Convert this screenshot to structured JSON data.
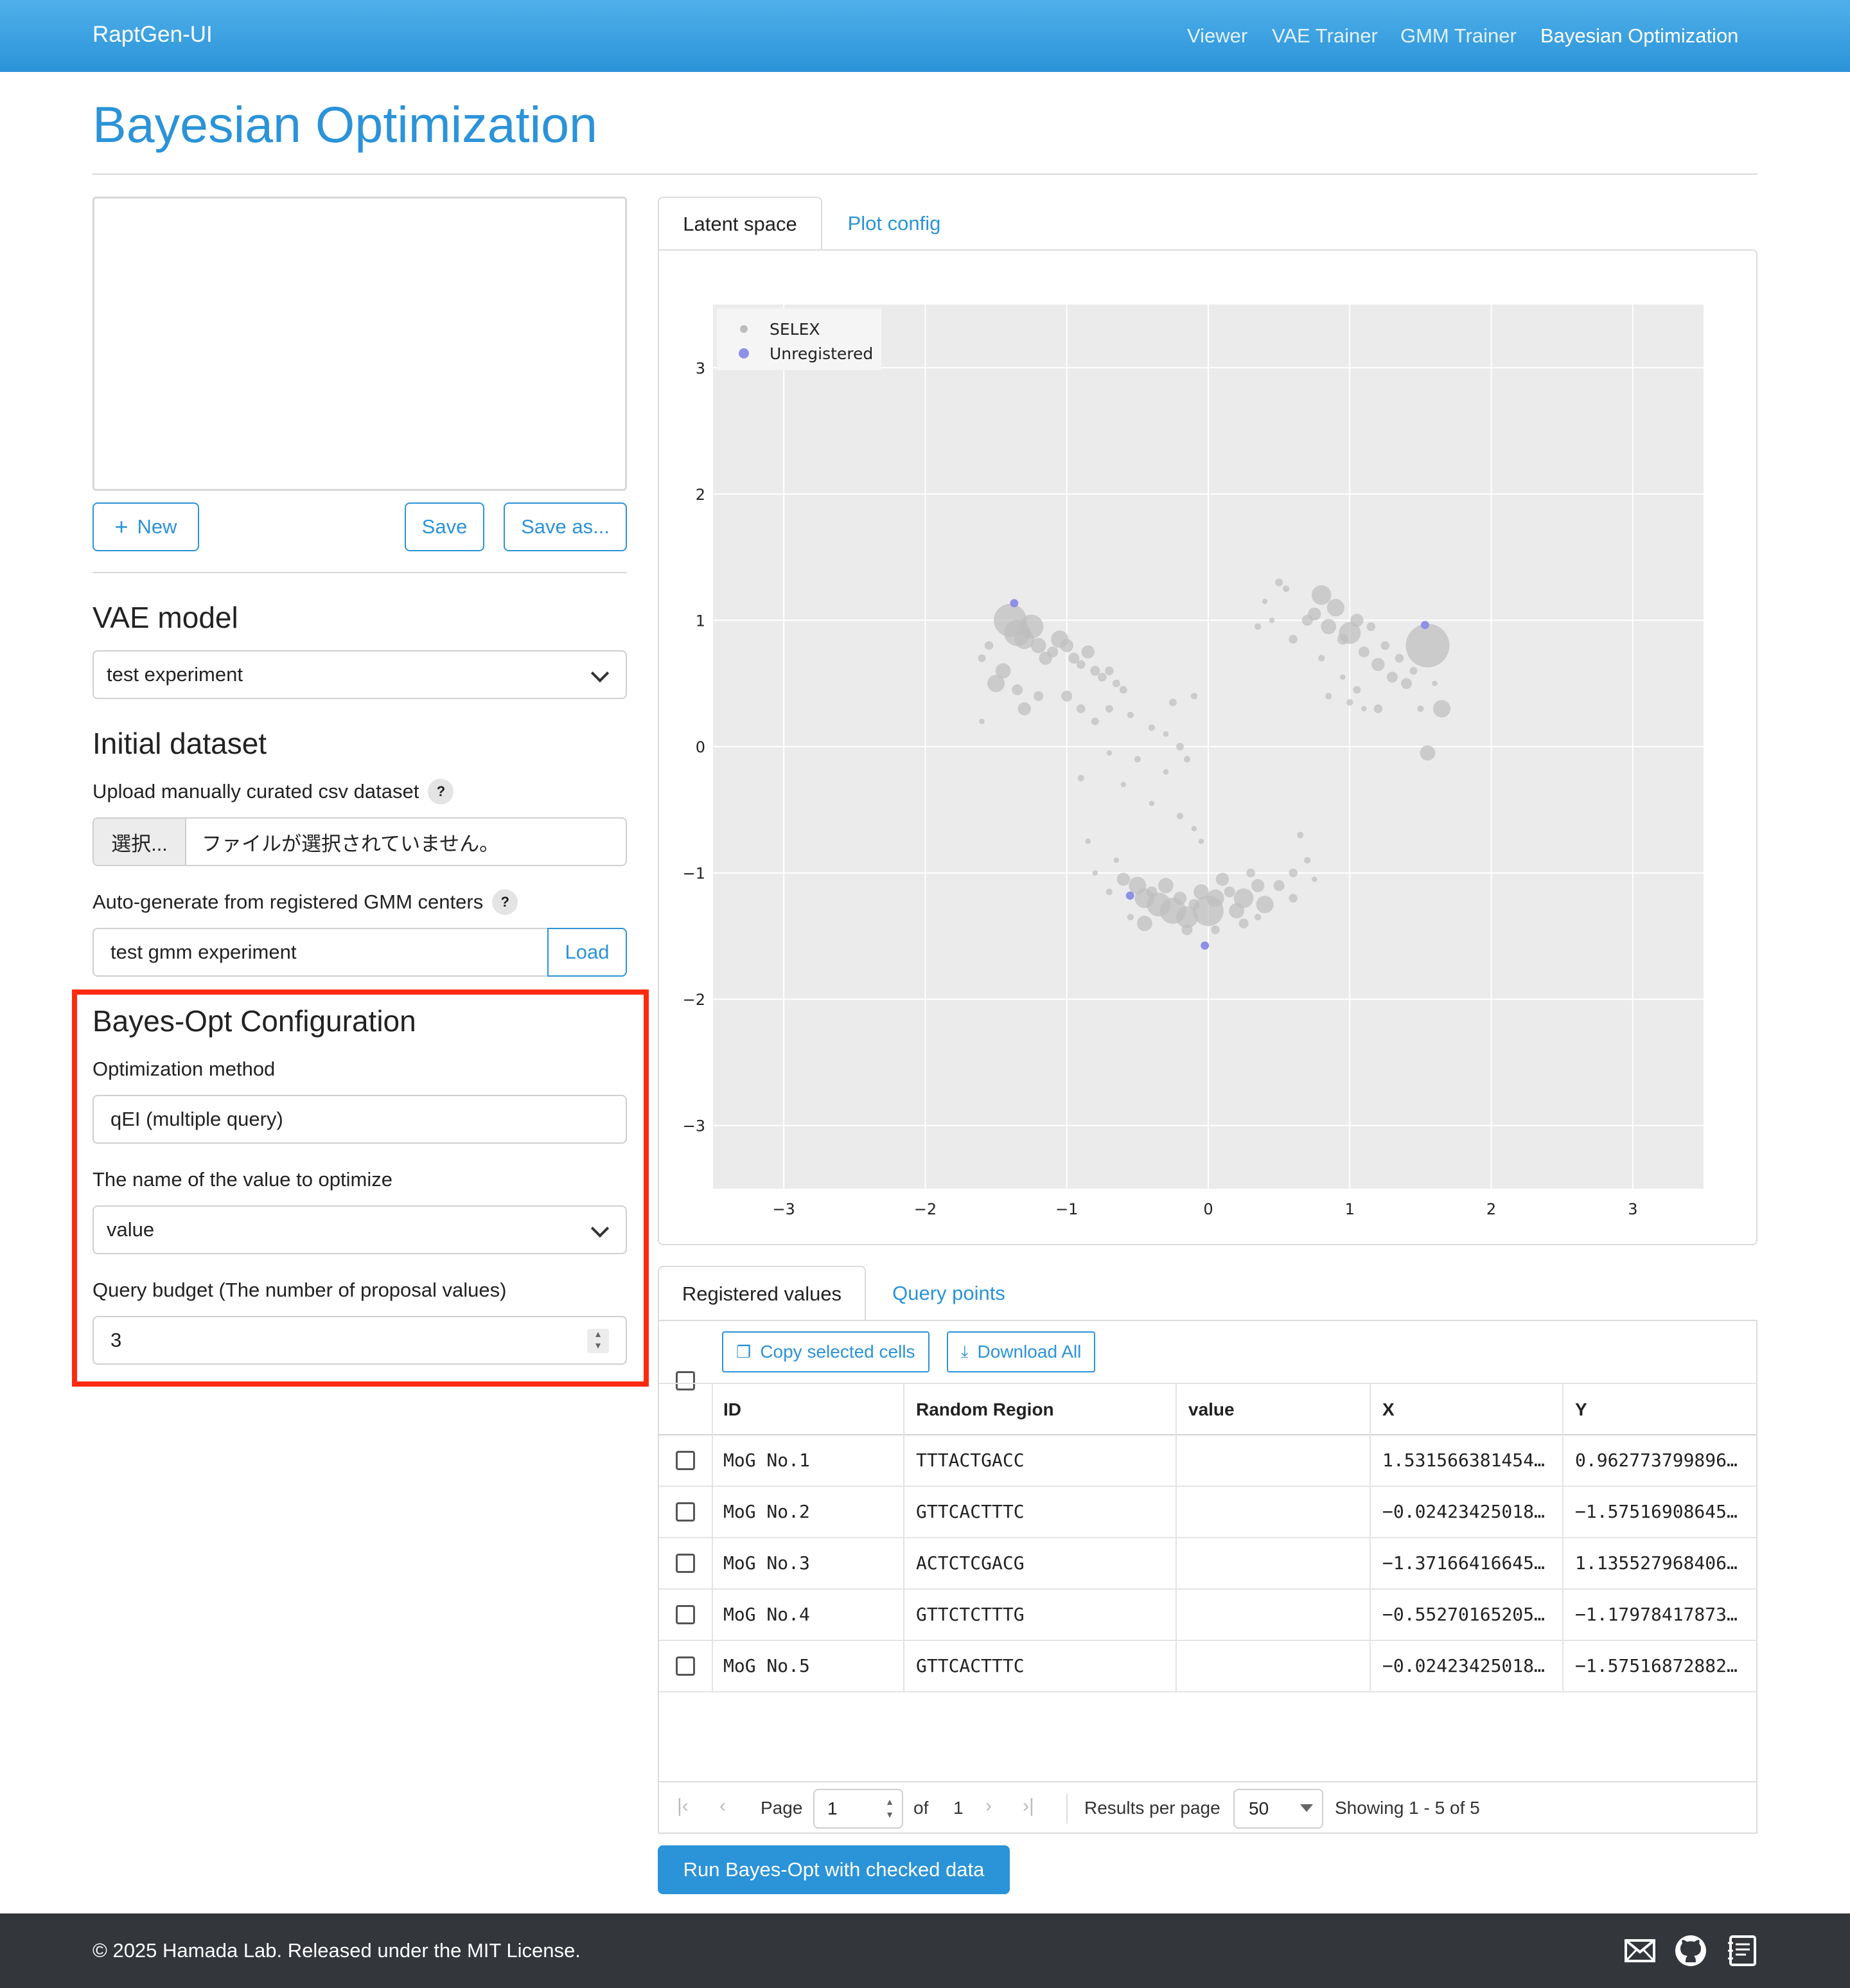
{
  "navbar": {
    "brand": "RaptGen-UI",
    "links": [
      "Viewer",
      "VAE Trainer",
      "GMM Trainer",
      "Bayesian Optimization"
    ],
    "active": "Bayesian Optimization"
  },
  "page_title": "Bayesian Optimization",
  "config_editor": {
    "content": "",
    "new_label": "New",
    "save_label": "Save",
    "save_as_label": "Save as..."
  },
  "vae_model": {
    "heading": "VAE model",
    "selected": "test experiment"
  },
  "initial_dataset": {
    "heading": "Initial dataset",
    "upload_label": "Upload manually curated csv dataset",
    "help": "?",
    "file_button": "選択...",
    "file_status": "ファイルが選択されていません。",
    "auto_label": "Auto-generate from registered GMM centers",
    "gmm_value": "test gmm experiment",
    "load_label": "Load"
  },
  "bayes_config": {
    "heading": "Bayes-Opt Configuration",
    "method_label": "Optimization method",
    "method_value": "qEI (multiple query)",
    "target_label": "The name of the value to optimize",
    "target_value": "value",
    "budget_label": "Query budget (The number of proposal values)",
    "budget_value": "3"
  },
  "plot_tabs": [
    "Latent space",
    "Plot config"
  ],
  "chart_data": {
    "type": "scatter",
    "title": "",
    "xlabel": "",
    "ylabel": "",
    "xlim": [
      -3.5,
      3.5
    ],
    "ylim": [
      -3.5,
      3.5
    ],
    "xticks": [
      "−3",
      "−2",
      "−1",
      "0",
      "1",
      "2",
      "3"
    ],
    "yticks": [
      "−3",
      "−2",
      "−1",
      "0",
      "1",
      "2",
      "3"
    ],
    "legend_position": "top-left",
    "grid": true,
    "background": "#ebebeb",
    "series": [
      {
        "name": "SELEX",
        "color": "#bdbdbd",
        "points": [
          [
            -1.4,
            1.0
          ],
          [
            -1.35,
            0.9
          ],
          [
            -1.3,
            0.85
          ],
          [
            -1.25,
            0.95
          ],
          [
            -1.2,
            0.8
          ],
          [
            -1.15,
            0.7
          ],
          [
            -1.1,
            0.75
          ],
          [
            -1.05,
            0.85
          ],
          [
            -1.0,
            0.8
          ],
          [
            -0.95,
            0.7
          ],
          [
            -0.9,
            0.65
          ],
          [
            -0.85,
            0.75
          ],
          [
            -0.8,
            0.6
          ],
          [
            -0.75,
            0.55
          ],
          [
            -0.7,
            0.6
          ],
          [
            -0.65,
            0.5
          ],
          [
            -0.6,
            0.45
          ],
          [
            -1.45,
            0.6
          ],
          [
            -1.5,
            0.5
          ],
          [
            -1.35,
            0.45
          ],
          [
            -1.3,
            0.3
          ],
          [
            -1.55,
            0.8
          ],
          [
            -1.6,
            0.7
          ],
          [
            -1.6,
            0.2
          ],
          [
            -1.2,
            0.4
          ],
          [
            -1.0,
            0.4
          ],
          [
            -0.9,
            0.3
          ],
          [
            -0.8,
            0.2
          ],
          [
            -0.7,
            0.3
          ],
          [
            -0.55,
            0.25
          ],
          [
            -0.4,
            0.15
          ],
          [
            -0.3,
            0.1
          ],
          [
            -0.2,
            0.0
          ],
          [
            -0.25,
            0.35
          ],
          [
            -0.1,
            0.4
          ],
          [
            -0.15,
            -0.1
          ],
          [
            -0.3,
            -0.2
          ],
          [
            -0.5,
            -0.1
          ],
          [
            -0.7,
            -0.05
          ],
          [
            -0.9,
            -0.25
          ],
          [
            -0.6,
            -0.3
          ],
          [
            -0.4,
            -0.45
          ],
          [
            -0.2,
            -0.55
          ],
          [
            -0.1,
            -0.65
          ],
          [
            -0.05,
            -0.75
          ],
          [
            -0.65,
            -0.9
          ],
          [
            -0.8,
            -1.0
          ],
          [
            -0.6,
            -1.05
          ],
          [
            -0.5,
            -1.1
          ],
          [
            -0.45,
            -1.2
          ],
          [
            -0.4,
            -1.15
          ],
          [
            -0.35,
            -1.25
          ],
          [
            -0.3,
            -1.1
          ],
          [
            -0.25,
            -1.3
          ],
          [
            -0.2,
            -1.2
          ],
          [
            -0.15,
            -1.35
          ],
          [
            -0.1,
            -1.25
          ],
          [
            -0.05,
            -1.15
          ],
          [
            0.0,
            -1.3
          ],
          [
            0.05,
            -1.2
          ],
          [
            0.1,
            -1.05
          ],
          [
            0.15,
            -1.15
          ],
          [
            0.2,
            -1.3
          ],
          [
            0.25,
            -1.2
          ],
          [
            0.3,
            -1.0
          ],
          [
            0.35,
            -1.1
          ],
          [
            0.4,
            -1.25
          ],
          [
            0.5,
            -1.1
          ],
          [
            0.6,
            -1.0
          ],
          [
            0.7,
            -0.9
          ],
          [
            0.75,
            -1.05
          ],
          [
            0.6,
            -1.2
          ],
          [
            -0.55,
            -1.35
          ],
          [
            -0.45,
            -1.4
          ],
          [
            -0.15,
            -1.45
          ],
          [
            0.05,
            -1.45
          ],
          [
            0.25,
            -1.4
          ],
          [
            0.35,
            -1.35
          ],
          [
            -0.7,
            -1.15
          ],
          [
            -0.85,
            -0.75
          ],
          [
            0.65,
            -0.7
          ],
          [
            0.6,
            0.85
          ],
          [
            0.7,
            1.0
          ],
          [
            0.75,
            1.05
          ],
          [
            0.8,
            1.2
          ],
          [
            0.85,
            0.95
          ],
          [
            0.9,
            1.1
          ],
          [
            0.95,
            0.85
          ],
          [
            1.0,
            0.9
          ],
          [
            1.05,
            1.0
          ],
          [
            1.1,
            0.75
          ],
          [
            1.15,
            0.95
          ],
          [
            1.2,
            0.65
          ],
          [
            1.25,
            0.8
          ],
          [
            1.3,
            0.55
          ],
          [
            1.35,
            0.7
          ],
          [
            1.4,
            0.5
          ],
          [
            1.45,
            0.6
          ],
          [
            1.5,
            0.3
          ],
          [
            0.95,
            0.55
          ],
          [
            1.0,
            0.35
          ],
          [
            1.05,
            0.45
          ],
          [
            1.1,
            0.3
          ],
          [
            1.2,
            0.3
          ],
          [
            0.85,
            0.4
          ],
          [
            0.8,
            0.7
          ],
          [
            0.5,
            1.3
          ],
          [
            0.55,
            1.25
          ],
          [
            0.4,
            1.15
          ],
          [
            0.35,
            0.95
          ],
          [
            0.45,
            1.0
          ],
          [
            1.6,
            0.5
          ],
          [
            1.55,
            0.8
          ],
          [
            1.65,
            0.3
          ],
          [
            1.55,
            -0.05
          ]
        ],
        "sizes": [
          30,
          24,
          18,
          22,
          14,
          12,
          10,
          16,
          12,
          10,
          8,
          12,
          9,
          8,
          8,
          7,
          7,
          14,
          16,
          10,
          12,
          8,
          7,
          5,
          9,
          10,
          8,
          7,
          7,
          6,
          6,
          5,
          7,
          7,
          6,
          6,
          5,
          6,
          5,
          6,
          5,
          5,
          6,
          5,
          5,
          5,
          5,
          12,
          16,
          18,
          10,
          22,
          14,
          24,
          12,
          20,
          10,
          14,
          28,
          16,
          12,
          10,
          14,
          18,
          8,
          12,
          16,
          10,
          8,
          6,
          5,
          8,
          6,
          14,
          10,
          8,
          9,
          6,
          6,
          5,
          6,
          8,
          10,
          12,
          18,
          14,
          16,
          10,
          20,
          12,
          10,
          8,
          12,
          8,
          10,
          8,
          10,
          7,
          6,
          5,
          6,
          7,
          5,
          8,
          6,
          6,
          7,
          6,
          5,
          6,
          5,
          5,
          40,
          16,
          14,
          5
        ]
      },
      {
        "name": "Unregistered",
        "color": "#8f8fe8",
        "points": [
          [
            1.531566381454,
            0.962773799896
          ],
          [
            -0.02423425018,
            -1.57516908645
          ],
          [
            -1.37166416645,
            1.135527968406
          ],
          [
            -0.55270165205,
            -1.17978417873
          ]
        ],
        "sizes": [
          4,
          4,
          4,
          4
        ]
      }
    ]
  },
  "table_tabs": [
    "Registered values",
    "Query points"
  ],
  "table": {
    "copy_label": "Copy selected cells",
    "download_label": "Download All",
    "columns": [
      "ID",
      "Random Region",
      "value",
      "X",
      "Y"
    ],
    "rows": [
      [
        "MoG No.1",
        "TTTACTGACC",
        "",
        "1.531566381454…",
        "0.962773799896…"
      ],
      [
        "MoG No.2",
        "GTTCACTTTC",
        "",
        "−0.02423425018…",
        "−1.57516908645…"
      ],
      [
        "MoG No.3",
        "ACTCTCGACG",
        "",
        "−1.37166416645…",
        "1.135527968406…"
      ],
      [
        "MoG No.4",
        "GTTCTCTTTG",
        "",
        "−0.55270165205…",
        "−1.17978417873…"
      ],
      [
        "MoG No.5",
        "GTTCACTTTC",
        "",
        "−0.02423425018…",
        "−1.57516872882…"
      ]
    ]
  },
  "pager": {
    "page_label": "Page",
    "page": "1",
    "of_label": "of",
    "total_pages": "1",
    "per_page_label": "Results per page",
    "per_page": "50",
    "showing": "Showing 1 - 5 of 5"
  },
  "run_button": "Run Bayes-Opt with checked data",
  "footer": {
    "text": "© 2025 Hamada Lab. Released under the MIT License.",
    "icons": [
      "mail-icon",
      "github-icon",
      "document-icon"
    ]
  },
  "colors": {
    "primary": "#2b93d8",
    "highlight": "#ff2a0f",
    "footer_bg": "#33363b"
  }
}
